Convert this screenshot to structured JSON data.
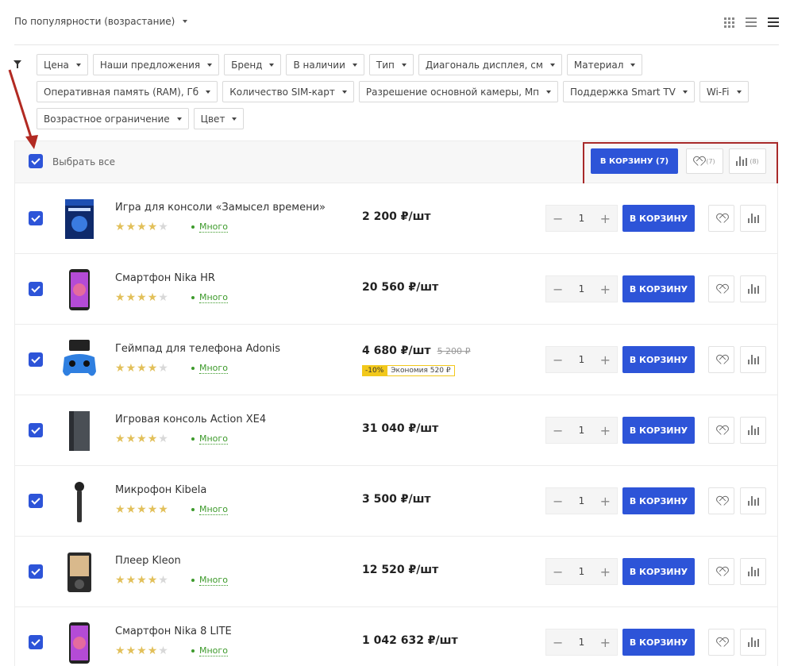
{
  "sort": {
    "label": "По популярности (возрастание)"
  },
  "filters": [
    [
      "Цена",
      "Наши предложения",
      "Бренд",
      "В наличии",
      "Тип",
      "Диагональ дисплея, см",
      "Материал"
    ],
    [
      "Оперативная память (RAM), Гб",
      "Количество SIM-карт",
      "Разрешение основной камеры, Мп",
      "Поддержка Smart TV",
      "Wi-Fi"
    ],
    [
      "Возрастное ограничение",
      "Цвет"
    ]
  ],
  "select_bar": {
    "select_all_label": "Выбрать все",
    "cart_all_label": "В КОРЗИНУ (7)",
    "favorites_count": "(7)",
    "compare_count": "(8)"
  },
  "colors": {
    "accent": "#2d54d8",
    "stars": "#e2c05a",
    "availability": "#3d9a2b",
    "highlight_box": "#a82a2a"
  },
  "products": [
    {
      "name": "Игра для консоли «Замысел времени»",
      "rating": 4,
      "availability": "Много",
      "price": "2 200 ₽/шт",
      "old_price": "",
      "discount": "",
      "economy": "",
      "qty": "1",
      "cart_label": "В КОРЗИНУ",
      "icon": "game-disc-icon"
    },
    {
      "name": "Смартфон Nika HR",
      "rating": 4,
      "availability": "Много",
      "price": "20 560 ₽/шт",
      "old_price": "",
      "discount": "",
      "economy": "",
      "qty": "1",
      "cart_label": "В КОРЗИНУ",
      "icon": "smartphone-icon"
    },
    {
      "name": "Геймпад для телефона Adonis",
      "rating": 4,
      "availability": "Много",
      "price": "4 680 ₽/шт",
      "old_price": "5 200 ₽",
      "discount": "-10%",
      "economy": "Экономия 520 ₽",
      "qty": "1",
      "cart_label": "В КОРЗИНУ",
      "icon": "gamepad-icon"
    },
    {
      "name": "Игровая консоль Action XE4",
      "rating": 4,
      "availability": "Много",
      "price": "31 040 ₽/шт",
      "old_price": "",
      "discount": "",
      "economy": "",
      "qty": "1",
      "cart_label": "В КОРЗИНУ",
      "icon": "console-icon"
    },
    {
      "name": "Микрофон Kibela",
      "rating": 5,
      "availability": "Много",
      "price": "3 500 ₽/шт",
      "old_price": "",
      "discount": "",
      "economy": "",
      "qty": "1",
      "cart_label": "В КОРЗИНУ",
      "icon": "microphone-icon"
    },
    {
      "name": "Плеер Kleon",
      "rating": 4,
      "availability": "Много",
      "price": "12 520 ₽/шт",
      "old_price": "",
      "discount": "",
      "economy": "",
      "qty": "1",
      "cart_label": "В КОРЗИНУ",
      "icon": "player-icon"
    },
    {
      "name": "Смартфон Nika 8 LITE",
      "rating": 4,
      "availability": "Много",
      "price": "1 042 632 ₽/шт",
      "old_price": "",
      "discount": "",
      "economy": "",
      "qty": "1",
      "cart_label": "В КОРЗИНУ",
      "icon": "smartphone-icon"
    }
  ]
}
